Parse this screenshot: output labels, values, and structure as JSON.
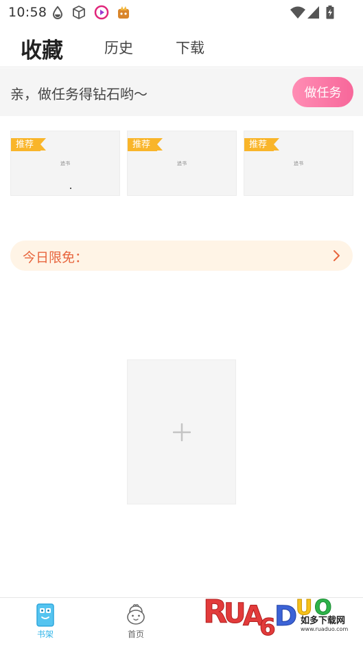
{
  "status_bar": {
    "time": "10:58",
    "left_icons": [
      "drop-icon",
      "cube-icon",
      "video-app-icon",
      "game-app-icon"
    ],
    "right_icons": [
      "wifi-icon",
      "cell-signal-icon",
      "battery-charging-icon"
    ]
  },
  "tabs": [
    {
      "label": "收藏",
      "active": true
    },
    {
      "label": "历史",
      "active": false
    },
    {
      "label": "下载",
      "active": false
    }
  ],
  "task_banner": {
    "text": "亲，做任务得钻石哟～",
    "button_label": "做任务",
    "button_color": "#f7679a"
  },
  "recommended": [
    {
      "badge": "推荐",
      "title": "追书"
    },
    {
      "badge": "推荐",
      "title": "追书"
    },
    {
      "badge": "推荐",
      "title": "追书"
    }
  ],
  "today_free": {
    "label": "今日限免：",
    "icon": "chevron-right-icon",
    "color": "#e7643c"
  },
  "add_book": {
    "icon": "plus-icon"
  },
  "bottom_nav": [
    {
      "label": "书架",
      "icon": "bookshelf-icon",
      "active": true,
      "color": "#2fb4e8"
    },
    {
      "label": "首页",
      "icon": "home-face-icon",
      "active": false,
      "color": "#666666"
    }
  ],
  "watermark": {
    "logo_text": "RUANDUO",
    "site_name": "如多下载网",
    "url": "www.ruaduo.com"
  }
}
